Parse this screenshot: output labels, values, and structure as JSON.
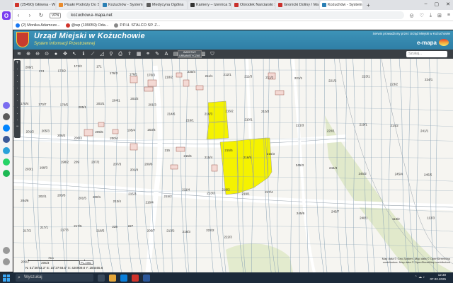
{
  "browser": {
    "tabs": [
      {
        "label": "(25490) Główna - WP Po...",
        "color": "#d0342c"
      },
      {
        "label": "Pisaki Podróży Do Sam...",
        "color": "#e98a2b"
      },
      {
        "label": "Kożuchów - System Infor...",
        "color": "#2a7fb4"
      },
      {
        "label": "Medycyna Ogólna",
        "color": "#5b5b5b"
      },
      {
        "label": "Kamery – Izernica Ski Ar...",
        "color": "#333333"
      },
      {
        "label": "Ośrodek Narciarski Sk...",
        "color": "#c9302c"
      },
      {
        "label": "Gronicki Doliny / Mas...",
        "color": "#c9302c"
      },
      {
        "label": "Kożuchów - System Infor...",
        "color": "#2a7fb4",
        "active": true
      }
    ],
    "url": "kozuchow.e-mapa.net",
    "vpn_badge": "VPN",
    "bookmarks": [
      "(2) Monika Adamcze...",
      "@wp (109059) Oda...",
      "P.P.H. STALCO SP. Z..."
    ]
  },
  "header": {
    "title": "Urząd Miejski w Kożuchowie",
    "subtitle": "System Informacji Przestrzennej",
    "provider_note": "Serwis prowadzony przez Urząd Miejski w Kożuchowie",
    "brand": "e-mapa"
  },
  "toolbar": {
    "layer_badge": "WARSTWY URBANISTYCZNE",
    "search_placeholder": "Szukaj..."
  },
  "map": {
    "parcels": {
      "left": [
        "289/1",
        "174",
        "173/2",
        "172/2",
        "171",
        "176/3",
        "176/1",
        "170/3",
        "170/4",
        "170/7",
        "170/5",
        "205/1",
        "203/1",
        "204/1",
        "203/2",
        "201/3",
        "201/2",
        "205/3",
        "206/2",
        "206/3",
        "205/5",
        "200/4",
        "195/4",
        "203/4",
        "203/1",
        "198/3",
        "198/2",
        "209",
        "207/2",
        "207/3",
        "201/4",
        "200/6",
        "204/6",
        "202/1",
        "203/3",
        "201/5",
        "200/1",
        "213/4",
        "215/3",
        "216/4",
        "217/2",
        "217/1",
        "217/3",
        "217/5",
        "218/5",
        "228",
        "227",
        "205/7",
        "205/2",
        "205/3"
      ],
      "mid": [
        "218/2",
        "230/4",
        "211/1",
        "212/1",
        "211/3",
        "211/2",
        "214/6",
        "216/1",
        "216/3",
        "216/2",
        "210/1",
        "210/2",
        "215",
        "215/6",
        "215/4",
        "215/5",
        "216/5",
        "215/3",
        "215/2",
        "211/4",
        "213/3",
        "219/2",
        "219/1",
        "217/4",
        "213/2",
        "218/3",
        "222/2",
        "222/3"
      ],
      "right": [
        "221/1",
        "221/2",
        "223/1",
        "223/2",
        "224/1",
        "221/3",
        "220/1",
        "219/1",
        "214/2",
        "241/1",
        "245/3",
        "244/3",
        "245/2",
        "245/4",
        "245/5",
        "245/6",
        "245/7",
        "248/1",
        "113/2",
        "113/3"
      ],
      "highlighted": [
        "210/1",
        "210/2",
        "216/4",
        "216/3",
        "216/2"
      ]
    },
    "scale_label": "75m",
    "scale_select": "PL-1991",
    "coords": "N: 51°36'53.3\"  E: 15°37'48.5\"  X: 420909.8  Y: 284465.6",
    "attribution": "Map data © Geo-System, Map data © OpenStreetMap contributors. Map data © OpenStreetMap contributors"
  },
  "taskbar": {
    "search_label": "Wyszukaj",
    "time": "12:30",
    "date": "07.02.2025"
  },
  "colors": {
    "banner": "#3689b0",
    "highlight": "#f5f200",
    "toolbar": "#3a3f44"
  }
}
